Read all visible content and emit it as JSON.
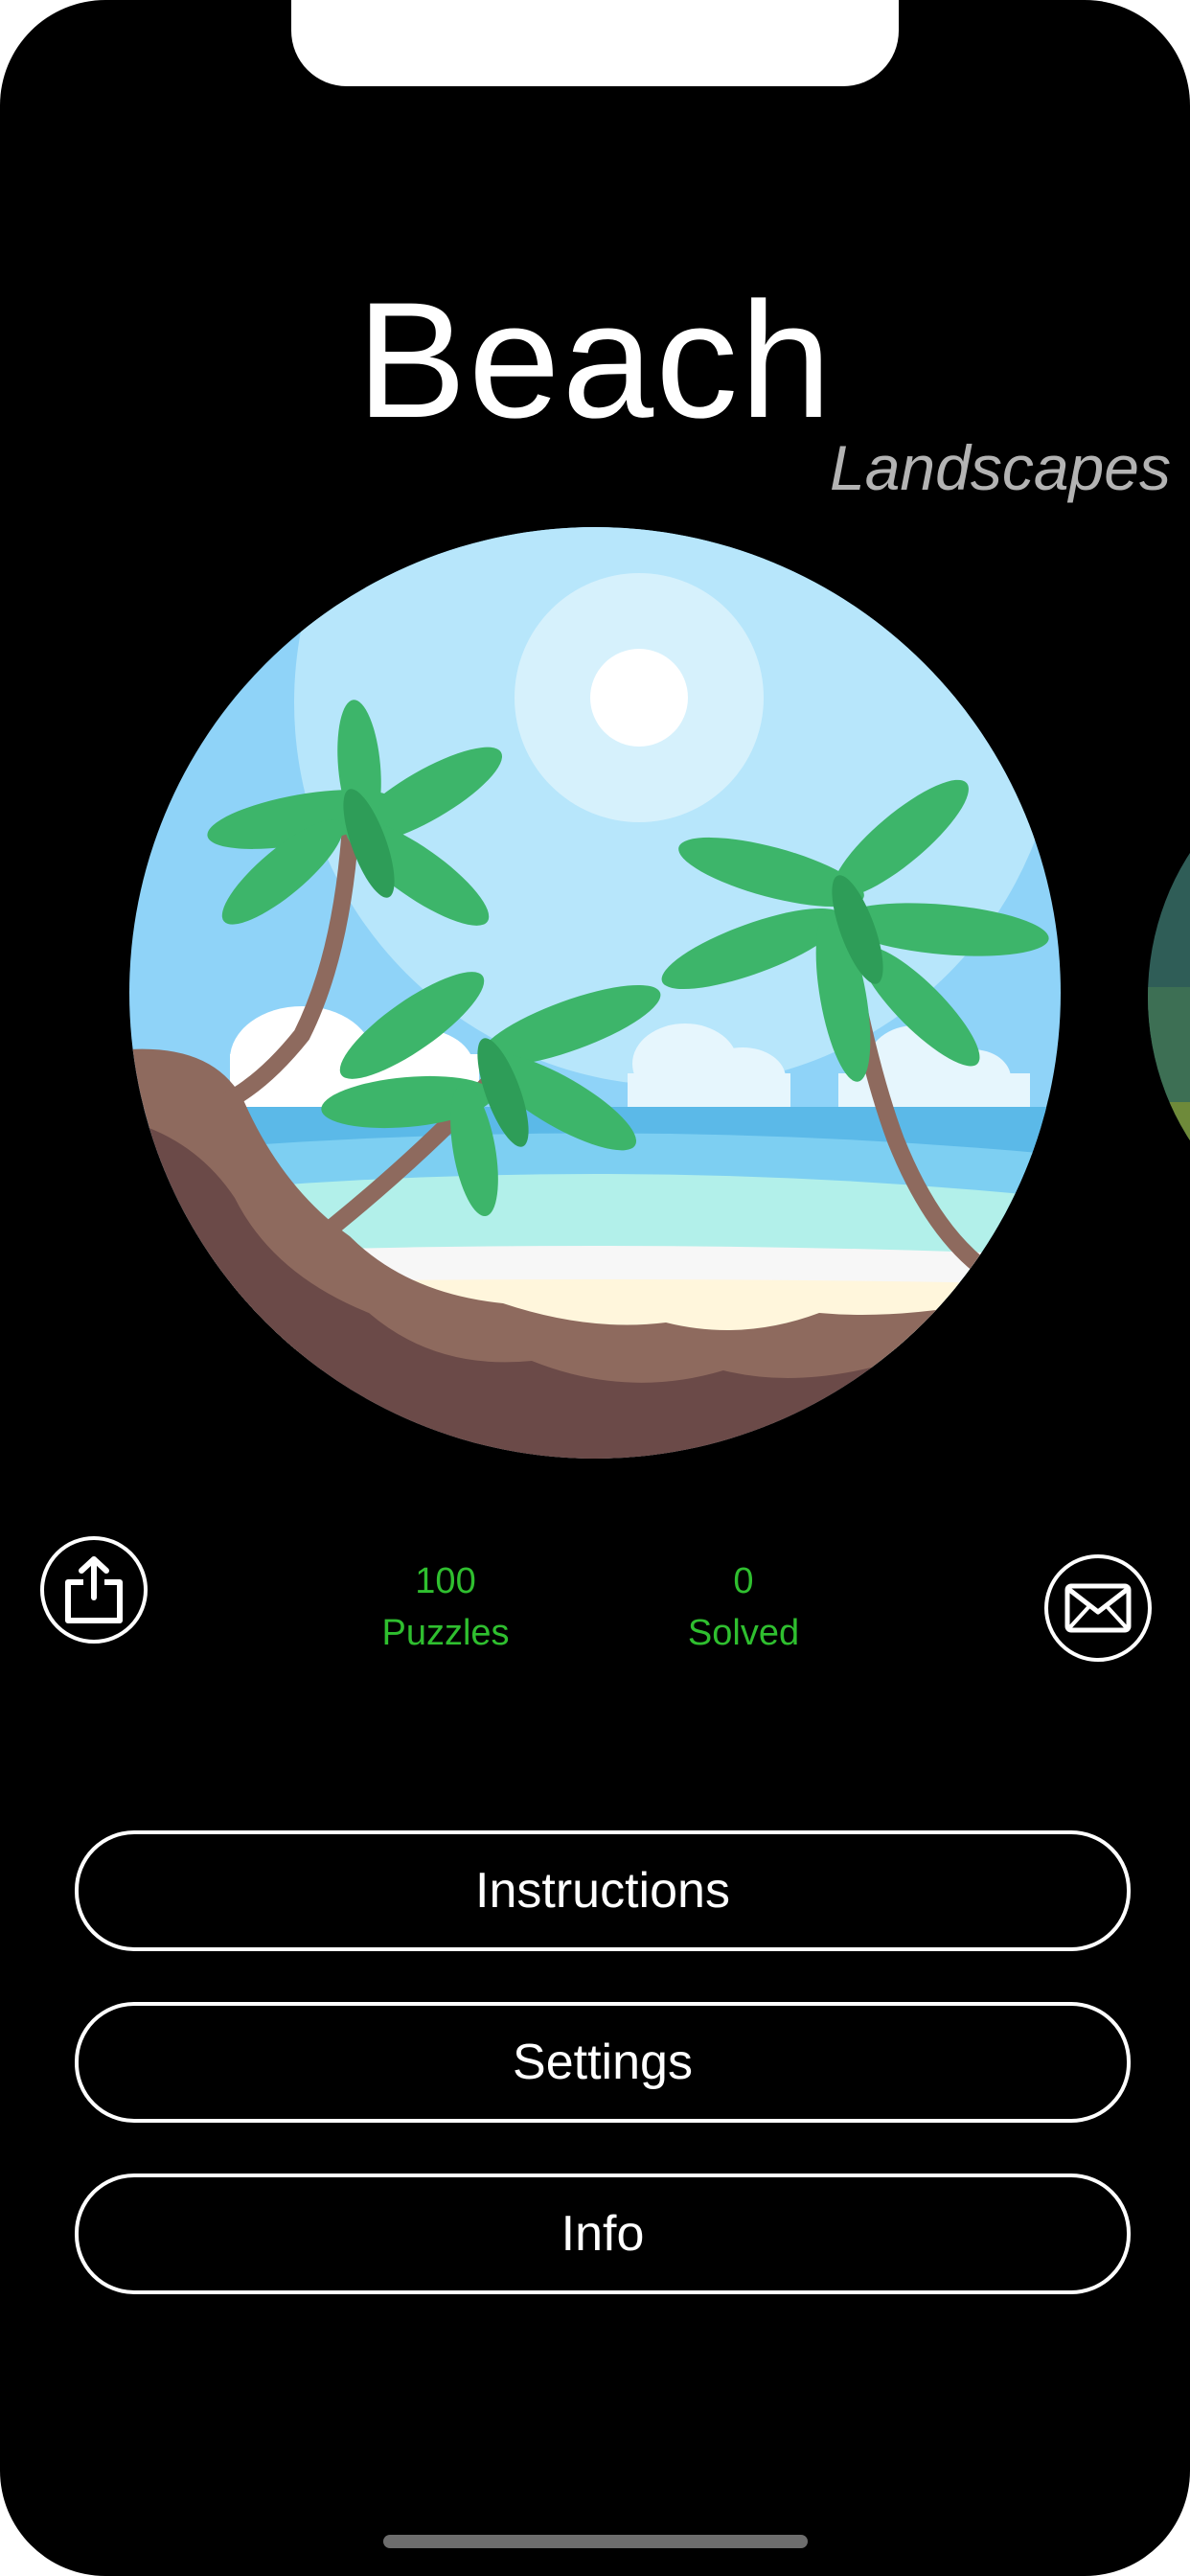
{
  "header": {
    "title": "Beach",
    "category": "Landscapes"
  },
  "stats": {
    "puzzles_count": "100",
    "puzzles_label": "Puzzles",
    "solved_count": "0",
    "solved_label": "Solved"
  },
  "actions": {
    "share_icon": "share-icon",
    "mail_icon": "mail-icon"
  },
  "menu": {
    "instructions": "Instructions",
    "settings": "Settings",
    "info": "Info"
  },
  "colors": {
    "background": "#000000",
    "accent_green": "#2fbf2f",
    "subtitle_gray": "#b3b3b3",
    "button_outline": "#ffffff"
  }
}
